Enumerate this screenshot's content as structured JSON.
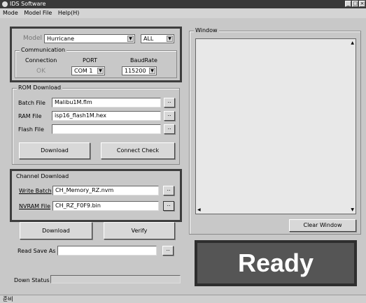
{
  "window": {
    "title": "IDS Software",
    "controls": [
      "_",
      "□",
      "×"
    ]
  },
  "menu": {
    "items": [
      "Mode",
      "Model File",
      "Help(H)"
    ]
  },
  "model": {
    "label": "Model",
    "value": "Hurricane",
    "filter": "ALL"
  },
  "communication": {
    "title": "Communication",
    "connection_label": "Connection",
    "connection_value": "OK",
    "port_label": "PORT",
    "port_value": "COM 1",
    "baud_label": "BaudRate",
    "baud_value": "115200"
  },
  "rom_download": {
    "title": "ROM Download",
    "batch_label": "Batch File",
    "batch_value": "Malibu1M.flm",
    "ram_label": "RAM File",
    "ram_value": "isp16_flash1M.hex",
    "flash_label": "Flash File",
    "flash_value": "",
    "browse": "..",
    "download_label": "Download",
    "connect_label": "Connect Check"
  },
  "channel_download": {
    "title": "Channel Download",
    "write_label": "Write Batch",
    "write_value": "CH_Memory_RZ.nvm",
    "nvram_label": "NVRAM File",
    "nvram_value": "CH_RZ_F0F9.bin",
    "browse": "..",
    "download_label": "Download",
    "verify_label": "Verify"
  },
  "read_save": {
    "label": "Read Save As",
    "value": "",
    "browse": ".."
  },
  "down_status": {
    "label": "Down Status"
  },
  "window_panel": {
    "title": "Window",
    "clear_label": "Clear Window"
  },
  "ready": {
    "text": "Ready"
  },
  "statusbar": {
    "text": "준비"
  }
}
